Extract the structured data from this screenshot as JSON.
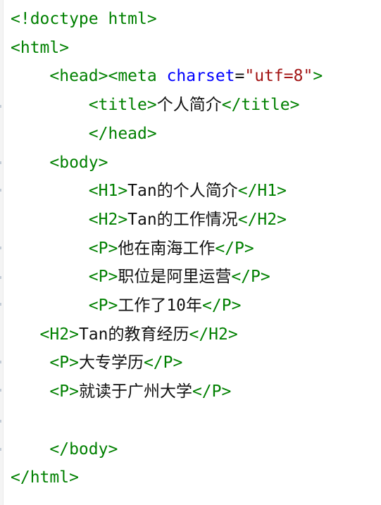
{
  "editor": {
    "lines": [
      {
        "id": "doctype",
        "indent": "",
        "segments": [
          {
            "cls": "tag",
            "text": "<!doctype html>"
          }
        ]
      },
      {
        "id": "html-open",
        "indent": "",
        "segments": [
          {
            "cls": "tag",
            "text": "<html>"
          }
        ]
      },
      {
        "id": "head-meta",
        "indent": "    ",
        "segments": [
          {
            "cls": "tag",
            "text": "<head>"
          },
          {
            "cls": "tag",
            "text": "<meta "
          },
          {
            "cls": "attr",
            "text": "charset"
          },
          {
            "cls": "text",
            "text": "="
          },
          {
            "cls": "str",
            "text": "\"utf=8\""
          },
          {
            "cls": "tag",
            "text": ">"
          }
        ]
      },
      {
        "id": "title",
        "indent": "        ",
        "segments": [
          {
            "cls": "tag",
            "text": "<title>"
          },
          {
            "cls": "text",
            "text": "个人简介"
          },
          {
            "cls": "tag",
            "text": "</title>"
          }
        ]
      },
      {
        "id": "head-close",
        "indent": "        ",
        "segments": [
          {
            "cls": "tag",
            "text": "</head>"
          }
        ]
      },
      {
        "id": "body-open",
        "indent": "    ",
        "segments": [
          {
            "cls": "tag",
            "text": "<body>"
          }
        ]
      },
      {
        "id": "h1-intro",
        "indent": "        ",
        "segments": [
          {
            "cls": "tag",
            "text": "<H1>"
          },
          {
            "cls": "text",
            "text": "Tan的个人简介"
          },
          {
            "cls": "tag",
            "text": "</H1>"
          }
        ]
      },
      {
        "id": "h2-work",
        "indent": "        ",
        "segments": [
          {
            "cls": "tag",
            "text": "<H2>"
          },
          {
            "cls": "text",
            "text": "Tan的工作情况"
          },
          {
            "cls": "tag",
            "text": "</H2>"
          }
        ]
      },
      {
        "id": "p-location",
        "indent": "        ",
        "segments": [
          {
            "cls": "tag",
            "text": "<P>"
          },
          {
            "cls": "text",
            "text": "他在南海工作"
          },
          {
            "cls": "tag",
            "text": "</P>"
          }
        ]
      },
      {
        "id": "p-position",
        "indent": "        ",
        "segments": [
          {
            "cls": "tag",
            "text": "<P>"
          },
          {
            "cls": "text",
            "text": "职位是阿里运营"
          },
          {
            "cls": "tag",
            "text": "</P>"
          }
        ]
      },
      {
        "id": "p-years",
        "indent": "        ",
        "segments": [
          {
            "cls": "tag",
            "text": "<P>"
          },
          {
            "cls": "text",
            "text": "工作了10年"
          },
          {
            "cls": "tag",
            "text": "</P>"
          }
        ]
      },
      {
        "id": "h2-education",
        "indent": "   ",
        "segments": [
          {
            "cls": "tag",
            "text": "<H2>"
          },
          {
            "cls": "text",
            "text": "Tan的教育经历"
          },
          {
            "cls": "tag",
            "text": "</H2>"
          }
        ]
      },
      {
        "id": "p-degree",
        "indent": "    ",
        "segments": [
          {
            "cls": "tag",
            "text": "<P>"
          },
          {
            "cls": "text",
            "text": "大专学历"
          },
          {
            "cls": "tag",
            "text": "</P>"
          }
        ]
      },
      {
        "id": "p-school",
        "indent": "    ",
        "segments": [
          {
            "cls": "tag",
            "text": "<P>"
          },
          {
            "cls": "text",
            "text": "就读于广州大学"
          },
          {
            "cls": "tag",
            "text": "</P>"
          }
        ]
      },
      {
        "id": "blank",
        "indent": "",
        "segments": []
      },
      {
        "id": "body-close",
        "indent": "    ",
        "segments": [
          {
            "cls": "tag",
            "text": "</body>"
          }
        ]
      },
      {
        "id": "html-close",
        "indent": "",
        "segments": [
          {
            "cls": "tag",
            "text": "</html>"
          }
        ]
      }
    ]
  }
}
